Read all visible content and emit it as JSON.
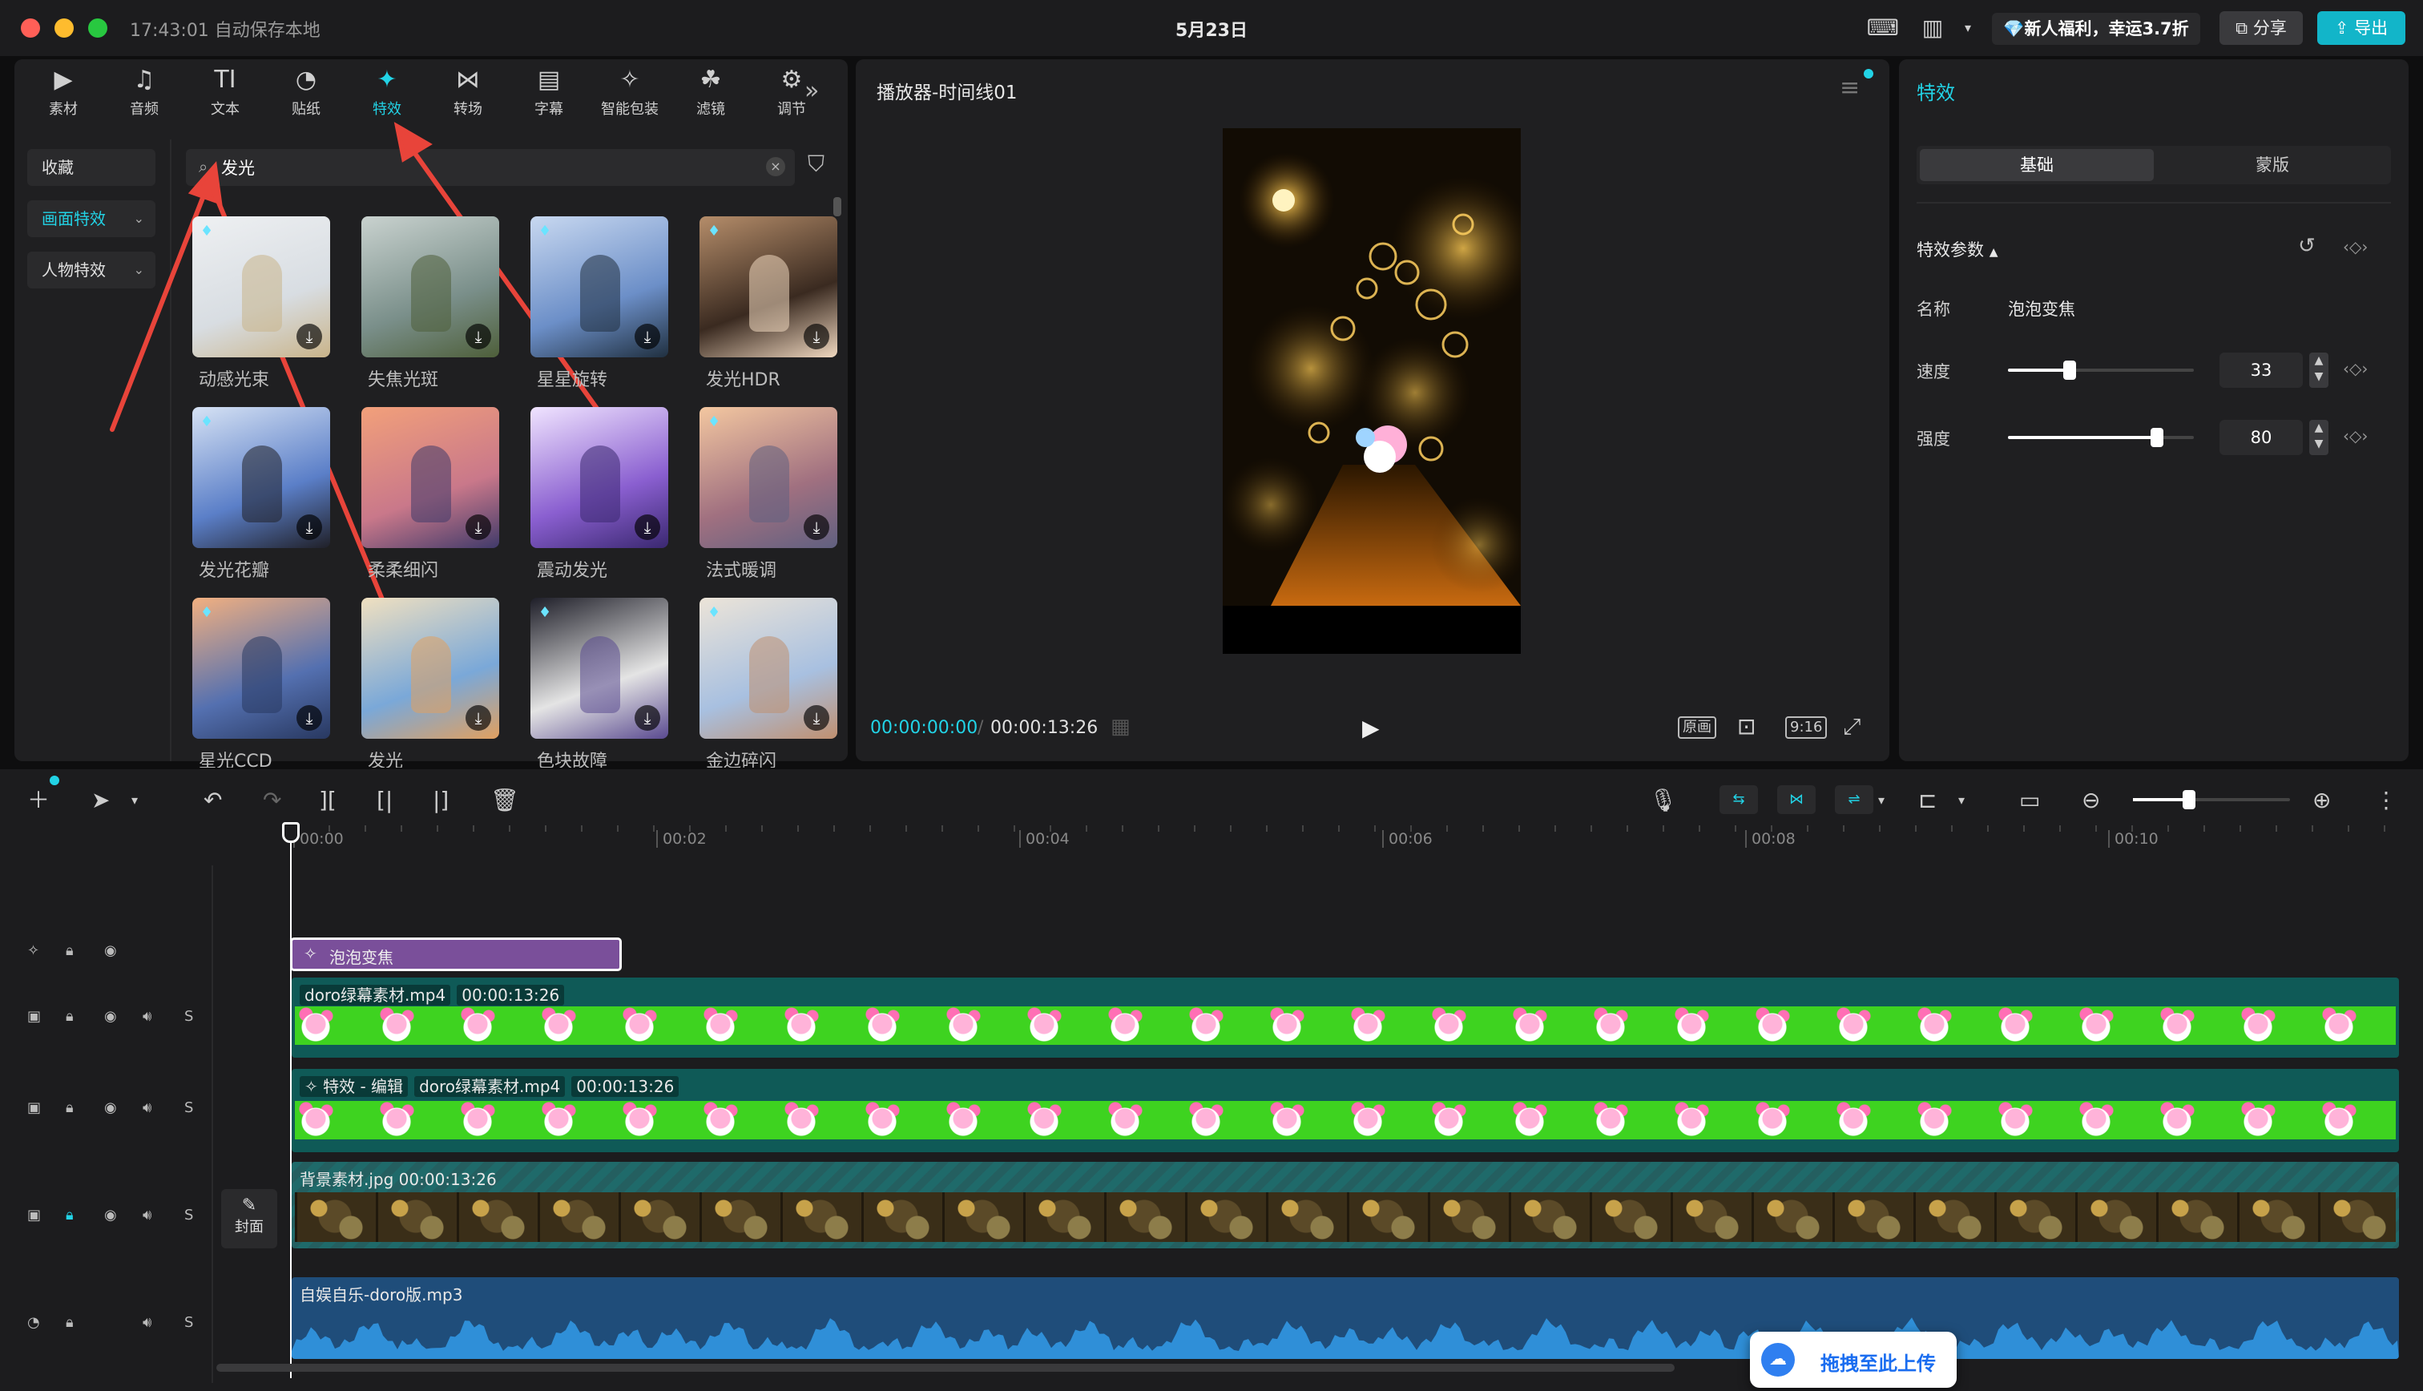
{
  "titlebar": {
    "autosave": "17:43:01 自动保存本地",
    "title": "5月23日",
    "promo": "💎新人福利，幸运3.7折",
    "share": "分享",
    "export": "导出"
  },
  "toolbar": {
    "tools": [
      {
        "icon": "▶",
        "label": "素材"
      },
      {
        "icon": "♫",
        "label": "音频"
      },
      {
        "icon": "TI",
        "label": "文本"
      },
      {
        "icon": "◔",
        "label": "贴纸"
      },
      {
        "icon": "✦",
        "label": "特效"
      },
      {
        "icon": "⋈",
        "label": "转场"
      },
      {
        "icon": "▤",
        "label": "字幕"
      },
      {
        "icon": "✧",
        "label": "智能包装"
      },
      {
        "icon": "☘",
        "label": "滤镜"
      },
      {
        "icon": "⚙",
        "label": "调节"
      }
    ],
    "active_index": 4,
    "more": "»"
  },
  "sidebar": {
    "items": [
      {
        "label": "收藏"
      },
      {
        "label": "画面特效"
      },
      {
        "label": "人物特效"
      }
    ]
  },
  "search": {
    "value": "发光",
    "clear": "×"
  },
  "effects": [
    {
      "label": "动感光束",
      "vip": true
    },
    {
      "label": "失焦光斑",
      "vip": false
    },
    {
      "label": "星星旋转",
      "vip": true
    },
    {
      "label": "发光HDR",
      "vip": true
    },
    {
      "label": "发光花瓣",
      "vip": true
    },
    {
      "label": "柔柔细闪",
      "vip": false
    },
    {
      "label": "震动发光",
      "vip": false
    },
    {
      "label": "法式暖调",
      "vip": true
    },
    {
      "label": "星光CCD",
      "vip": true
    },
    {
      "label": "发光",
      "vip": false
    },
    {
      "label": "色块故障",
      "vip": true
    },
    {
      "label": "金边碎闪",
      "vip": true
    }
  ],
  "player": {
    "title": "播放器-时间线01",
    "time_current": "00:00:00:00",
    "time_sep": "/",
    "time_total": "00:00:13:26",
    "ratio_btn": "原画",
    "aspect": "9:16"
  },
  "right_panel": {
    "title": "特效",
    "tabs": [
      "基础",
      "蒙版"
    ],
    "section": "特效参数",
    "name_label": "名称",
    "name_value": "泡泡变焦",
    "speed_label": "速度",
    "speed_value": "33",
    "strength_label": "强度",
    "strength_value": "80",
    "speed": 33,
    "strength": 80
  },
  "timeline": {
    "ruler": [
      "00:00",
      "00:02",
      "00:04",
      "00:06",
      "00:08",
      "00:10"
    ],
    "fx_clip": "泡泡变焦",
    "clip1_name": "doro绿幕素材.mp4",
    "clip1_dur": "00:00:13:26",
    "clip2_prefix": "特效 - 编辑",
    "clip2_name": "doro绿幕素材.mp4",
    "clip2_dur": "00:00:13:26",
    "clip3_name": "背景素材.jpg",
    "clip3_dur": "00:00:13:26",
    "audio_name": "自娱自乐-doro版.mp3",
    "cover": "封面",
    "solo_label": "S",
    "upload": "拖拽至此上传"
  },
  "colors": {
    "accent": "#22d3e6",
    "arrow": "#e8443a",
    "green_screen": "#3ed320",
    "fx_clip": "#7a4f9a",
    "audio_clip": "#1f4d7a"
  }
}
